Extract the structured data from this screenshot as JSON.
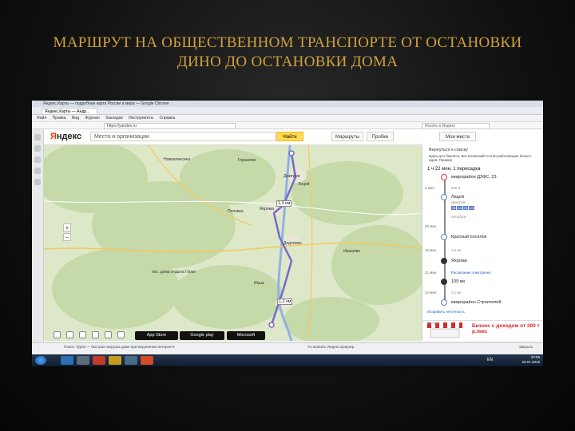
{
  "slide": {
    "title_line1": "МАРШРУТ НА ОБЩЕСТВЕННОМ ТРАНСПОРТЕ ОТ ОСТАНОВКИ",
    "title_line2": "ДИНО ДО ОСТАНОВКИ ДОМА"
  },
  "browser": {
    "window_title": "Яндекс.Карты — подробная карта России и мира — Google Chrome",
    "tab_label": "Яндекс.Карты — Андр...",
    "menu": [
      "Файл",
      "Правка",
      "Вид",
      "Журнал",
      "Закладки",
      "Инструменты",
      "Справка"
    ],
    "address": "https://yandex.ru",
    "search_box": "Искать в Яндекс"
  },
  "yandex": {
    "logo_letter": "Я",
    "logo_rest": "ндекс",
    "search_placeholder": "Места и организации",
    "find_button": "Найти",
    "routes_button": "Маршруты",
    "traffic_button": "Пробки",
    "my_places_button": "Мои места"
  },
  "map": {
    "towns": [
      "Новоалексино",
      "Горшково",
      "Дмитров",
      "Лицей",
      "Икша",
      "Яхрома",
      "Деденево",
      "пос. дома отдыха Горки",
      "Поповка",
      "Ивашево"
    ],
    "distance_labels": [
      "1,3 км",
      "1,2 км"
    ],
    "zoom_in": "+",
    "zoom_out": "−"
  },
  "route_panel": {
    "back_link": "Вернуться к списку",
    "ad_text": "Идеи для бизнеса. Без вложений! Сотни работающих бизнес-идей. Пример",
    "summary": "1 ч 22 мин, 1 пересадка",
    "steps": [
      {
        "time": "",
        "label": "микрорайон ДЗФС, 23",
        "note": ""
      },
      {
        "time": "2 мин",
        "label": "",
        "note": "200 м"
      },
      {
        "time": "",
        "label": "Лицей",
        "note": "Дмитров"
      },
      {
        "time": "20 мин",
        "label": "",
        "note": "Автобусы"
      },
      {
        "time": "",
        "label": "Красный поселок",
        "note": ""
      },
      {
        "time": "10 мин",
        "label": "",
        "note": "1,5 км"
      },
      {
        "time": "",
        "label": "Яхрома",
        "note": ""
      },
      {
        "time": "21 мин",
        "label": "Расписание электричек",
        "note": ""
      },
      {
        "time": "",
        "label": "109 км",
        "note": ""
      },
      {
        "time": "14 мин",
        "label": "",
        "note": "1,1 км"
      },
      {
        "time": "",
        "label": "микрорайон Строителей",
        "note": ""
      }
    ],
    "bus_numbers": [
      "36",
      "34",
      "26",
      "43"
    ],
    "edit_link": "Исправить неточность",
    "banner_text": "Бизнес с доходом от 300 т р./мес",
    "banner_label": "Реклама"
  },
  "map_status": "© Яндекс Условия использования",
  "app_buttons": [
    "App Store",
    "Google play",
    "Microsoft"
  ],
  "statusbar_text": "Поиск: Турбо — быстрая загрузка даже при медленном интернете",
  "statusbar_middle": "Установить Яндекс.Браузер",
  "statusbar_right": "Закрыть",
  "taskbar": {
    "lang": "EN",
    "time": "20:05",
    "date": "20.01.2016"
  },
  "colors": {
    "title": "#d1a13a",
    "route": "#7a68c8",
    "find_button": "#ffdb4d"
  }
}
